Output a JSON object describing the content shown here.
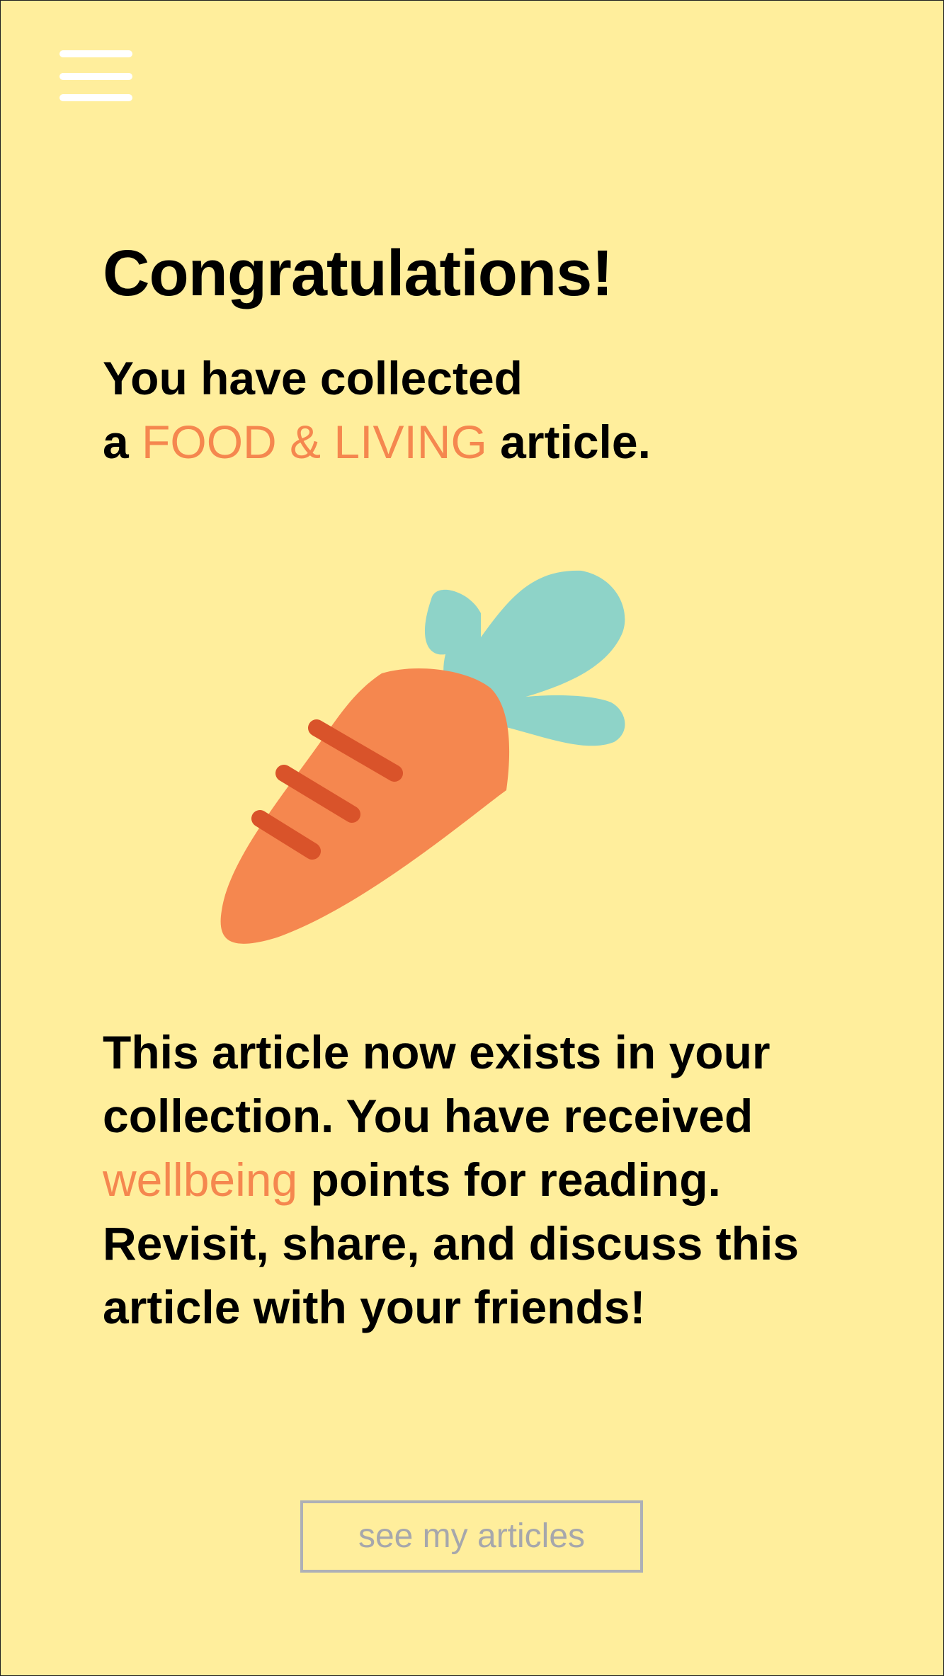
{
  "menu": {
    "icon": "hamburger-menu-icon"
  },
  "header": {
    "title": "Congratulations!",
    "line1": "You have collected",
    "line2_prefix": "a ",
    "category": "FOOD & LIVING",
    "line2_suffix": " article."
  },
  "illustration": {
    "icon": "carrot-icon",
    "colors": {
      "body": "#F5874F",
      "stripes": "#D9532A",
      "leaves": "#8ED3C8"
    }
  },
  "message": {
    "part1": "This article now exists in your collection. You have received ",
    "highlight": "wellbeing",
    "part2": " points for reading. Revisit, share, and  discuss this article with your friends!"
  },
  "cta": {
    "label": "see my articles"
  },
  "colors": {
    "background": "#FFEE9C",
    "accent": "#F5874F",
    "button_border": "#AEB0B6",
    "button_text": "#A6A7AC",
    "menu_icon": "#FFFFFF"
  }
}
